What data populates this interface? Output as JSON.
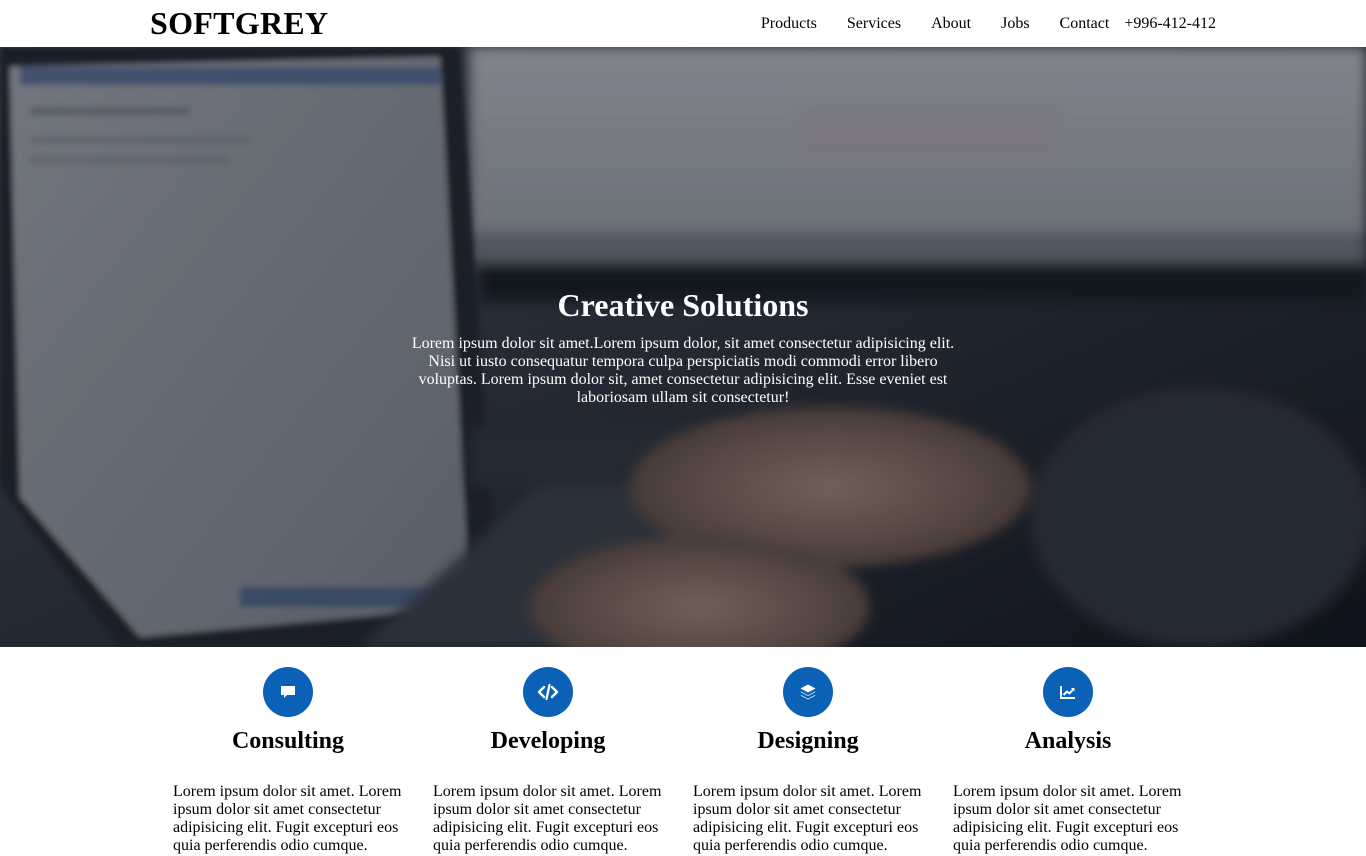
{
  "header": {
    "logo": "SOFTGREY",
    "nav": [
      "Products",
      "Services",
      "About",
      "Jobs",
      "Contact"
    ],
    "phone": "+996-412-412"
  },
  "hero": {
    "title": "Creative Solutions",
    "text": "Lorem ipsum dolor sit amet.Lorem ipsum dolor, sit amet consectetur adipisicing elit. Nisi ut iusto consequatur tempora culpa perspiciatis modi commodi error libero voluptas. Lorem ipsum dolor sit, amet consectetur adipisicing elit. Esse eveniet est laboriosam ullam sit consectetur!",
    "background": "laptop-typing-photo"
  },
  "services": [
    {
      "icon": "comment-icon",
      "title": "Consulting",
      "text": "Lorem ipsum dolor sit amet. Lorem ipsum dolor sit amet consectetur adipisicing elit. Fugit excepturi eos quia perferendis odio cumque."
    },
    {
      "icon": "code-icon",
      "title": "Developing",
      "text": "Lorem ipsum dolor sit amet. Lorem ipsum dolor sit amet consectetur adipisicing elit. Fugit excepturi eos quia perferendis odio cumque."
    },
    {
      "icon": "layers-icon",
      "title": "Designing",
      "text": "Lorem ipsum dolor sit amet. Lorem ipsum dolor sit amet consectetur adipisicing elit. Fugit excepturi eos quia perferendis odio cumque."
    },
    {
      "icon": "chart-line-icon",
      "title": "Analysis",
      "text": "Lorem ipsum dolor sit amet. Lorem ipsum dolor sit amet consectetur adipisicing elit. Fugit excepturi eos quia perferendis odio cumque."
    }
  ],
  "colors": {
    "accent": "#0a61b5",
    "header_bg": "#ffffff",
    "hero_text": "#ffffff"
  }
}
